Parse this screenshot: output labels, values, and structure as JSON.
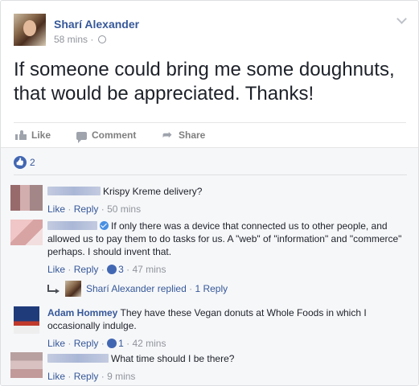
{
  "post": {
    "author": "Sharí Alexander",
    "time": "58 mins",
    "meta_sep": "·",
    "text": "If someone could bring me some doughnuts, that would be appreciated. Thanks!"
  },
  "actions": {
    "like": "Like",
    "comment": "Comment",
    "share": "Share"
  },
  "reactions": {
    "count": "2"
  },
  "comments": [
    {
      "text": "Krispy Kreme delivery?",
      "like": "Like",
      "reply": "Reply",
      "time": "50 mins"
    },
    {
      "text": "If only there was a device that connected us to other people, and allowed us to pay them to do tasks for us. A \"web\" of \"information\" and \"commerce\" perhaps. I should invent that.",
      "like": "Like",
      "reply": "Reply",
      "likes": "3",
      "time": "47 mins"
    },
    {
      "name": "Adam Hommey",
      "text": "They have these Vegan donuts at Whole Foods in which I occasionally indulge.",
      "like": "Like",
      "reply": "Reply",
      "likes": "1",
      "time": "42 mins"
    },
    {
      "text": "What time should I be there?",
      "like": "Like",
      "reply": "Reply",
      "time": "9 mins"
    }
  ],
  "reply_summary": {
    "name": "Sharí Alexander",
    "action": "replied",
    "sep": "·",
    "count": "1 Reply"
  },
  "colors": {
    "link": "#365899",
    "muted": "#90949c",
    "like_blue": "#4267b2",
    "comments_bg": "#f6f7f9"
  }
}
